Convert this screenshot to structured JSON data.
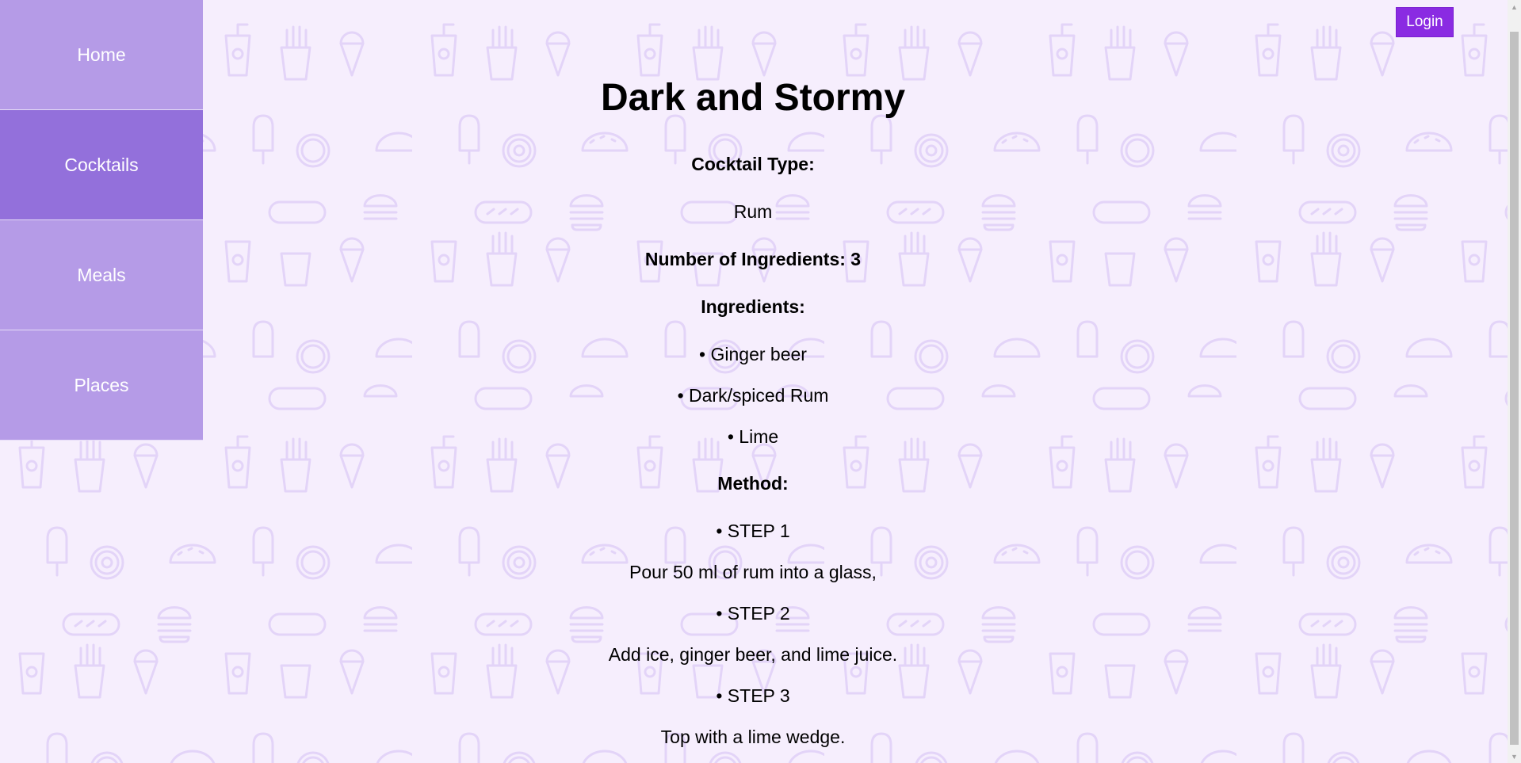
{
  "nav": {
    "items": [
      {
        "label": "Home"
      },
      {
        "label": "Cocktails"
      },
      {
        "label": "Meals"
      },
      {
        "label": "Places"
      }
    ],
    "active_index": 1
  },
  "header": {
    "login_label": "Login"
  },
  "cocktail": {
    "name": "Dark and Stormy",
    "type_heading": "Cocktail Type:",
    "type_value": "Rum",
    "count_heading": "Number of Ingredients: 3",
    "ingredients_heading": "Ingredients:",
    "ingredients": [
      "• Ginger beer",
      "• Dark/spiced Rum",
      "• Lime"
    ],
    "method_heading": "Method:",
    "steps": [
      {
        "label": "• STEP 1",
        "text": "Pour 50 ml of rum into a glass,"
      },
      {
        "label": "• STEP 2",
        "text": "Add ice, ginger beer, and lime juice."
      },
      {
        "label": "• STEP 3",
        "text": "Top with a lime wedge."
      }
    ]
  },
  "colors": {
    "background": "#f6eefd",
    "sidebar": "#b59be7",
    "sidebar_active": "#9370db",
    "login_button": "#8a2be2",
    "pattern": "#e3d4f8"
  }
}
